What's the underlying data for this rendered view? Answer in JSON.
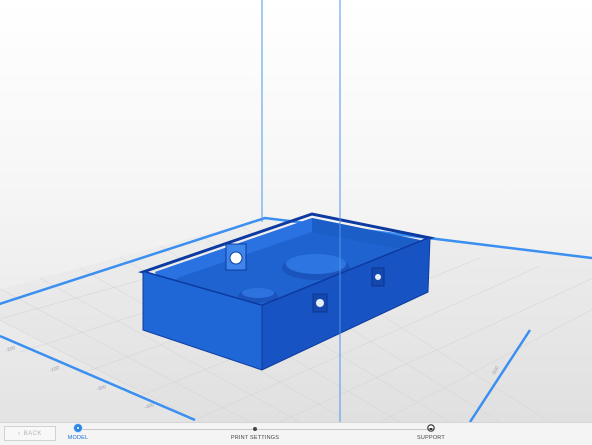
{
  "viewport": {
    "axis_labels": [
      "-200",
      "-100",
      "-300",
      "-400",
      "-500"
    ],
    "colors": {
      "model": "#1a5fd0",
      "bed_border": "#3a8ff0",
      "guide_line": "#4a97ea"
    }
  },
  "footer": {
    "back_label": "BACK",
    "back_icon": "chevron-left-icon",
    "steps": [
      {
        "label": "MODEL",
        "state": "active"
      },
      {
        "label": "PRINT SETTINGS",
        "state": "inactive"
      },
      {
        "label": "SUPPORT",
        "state": "inactive"
      }
    ],
    "accent_color": "#2f86e6"
  }
}
